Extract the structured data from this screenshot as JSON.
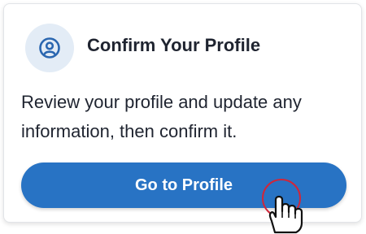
{
  "card": {
    "title": "Confirm Your Profile",
    "icon": "profile-icon",
    "description": "Review your profile and update any information, then confirm it.",
    "button_label": "Go to Profile"
  },
  "colors": {
    "accent": "#2873c4",
    "icon_bg": "#e3ecf6",
    "icon_fg": "#2a66b0",
    "click_ring": "#d0263a"
  },
  "cursor": {
    "icon": "hand-pointer-icon"
  }
}
